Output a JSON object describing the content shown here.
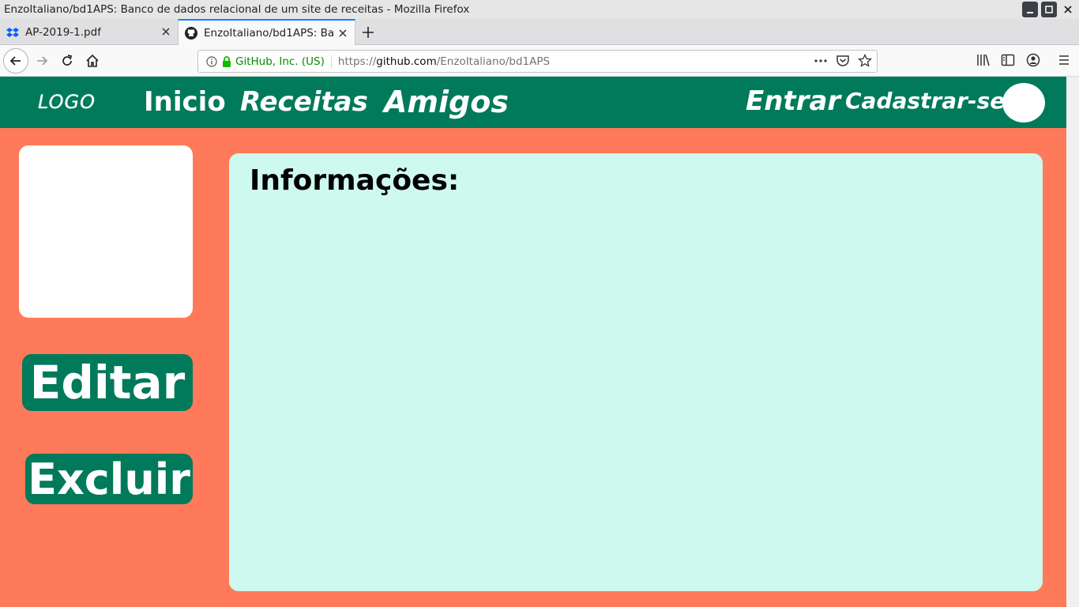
{
  "window": {
    "title": "EnzoItaliano/bd1APS: Banco de dados relacional de um site de receitas - Mozilla Firefox"
  },
  "tabs": [
    {
      "label": "AP-2019-1.pdf",
      "icon": "dropbox-icon"
    },
    {
      "label": "EnzoItaliano/bd1APS: Banco de dados relacional de um site de receitas",
      "icon": "github-icon"
    }
  ],
  "urlbar": {
    "identity": "GitHub, Inc. (US)",
    "scheme": "https://",
    "host": "github.com",
    "path": "/EnzoItaliano/bd1APS"
  },
  "site": {
    "logo": "LOGO",
    "nav": {
      "inicio": "Inicio",
      "receitas": "Receitas",
      "amigos": "Amigos",
      "entrar": "Entrar",
      "cadastrar": "Cadastrar-se"
    },
    "buttons": {
      "editar": "Editar",
      "excluir": "Excluir"
    },
    "info_title": "Informações:"
  },
  "colors": {
    "header": "#007a5a",
    "background": "#ff7a5a",
    "panel": "#cef9ee"
  }
}
